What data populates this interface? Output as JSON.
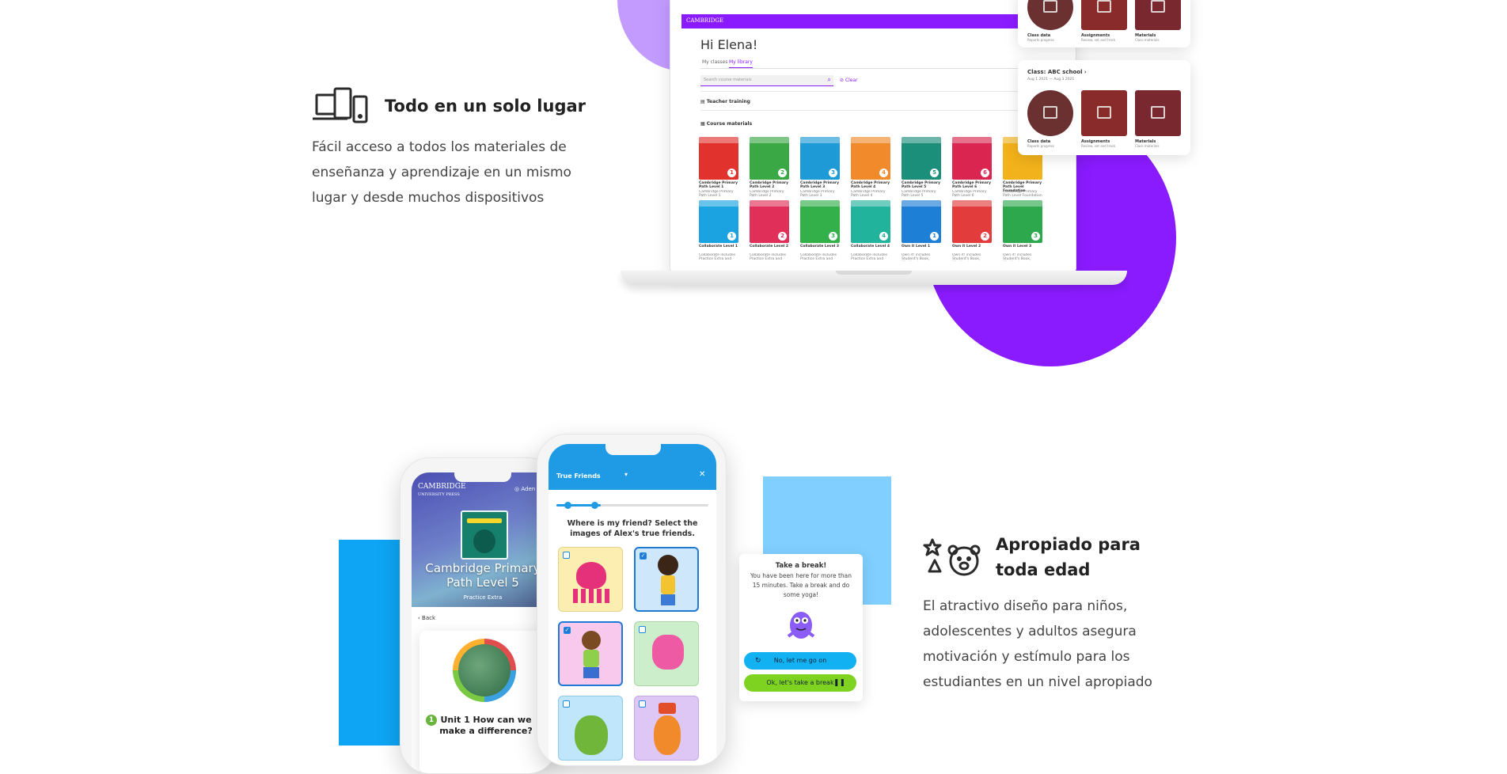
{
  "features": {
    "one_place": {
      "title": "Todo en un solo lugar",
      "description": "Fácil acceso a todos los materiales de enseñanza y aprendizaje en un mismo lugar y desde muchos dispositivos",
      "icon": "devices-icon"
    },
    "all_ages": {
      "title": "Apropiado para toda edad",
      "description": "El atractivo diseño para niños, adolescentes y adultos asegura motivación y estímulo para los estudiantes en un nivel apropiado",
      "icon": "star-triangle-bear-icon"
    }
  },
  "laptop": {
    "brand": "CAMBRIDGE",
    "greeting": "Hi Elena!",
    "tabs": [
      "My classes",
      "My library"
    ],
    "active_tab": "My library",
    "search_placeholder": "Search course materials",
    "clear_label": "Clear",
    "teacher_training": "Teacher training",
    "course_materials": "Course materials",
    "books_row1": [
      {
        "title": "Cambridge Primary Path Level 1",
        "sub": "Cambridge Primary Path Level 1",
        "color": "#e2322e",
        "num": "1"
      },
      {
        "title": "Cambridge Primary Path Level 2",
        "sub": "Cambridge Primary Path Level 2",
        "color": "#39a845",
        "num": "2"
      },
      {
        "title": "Cambridge Primary Path Level 3",
        "sub": "Cambridge Primary Path Level 3",
        "color": "#1e9ad6",
        "num": "3"
      },
      {
        "title": "Cambridge Primary Path Level 4",
        "sub": "Cambridge Primary Path Level 4",
        "color": "#f08a2b",
        "num": "4"
      },
      {
        "title": "Cambridge Primary Path Level 5",
        "sub": "Cambridge Primary Path Level 5",
        "color": "#1c8f7a",
        "num": "5"
      },
      {
        "title": "Cambridge Primary Path Level 6",
        "sub": "Cambridge Primary Path Level 6",
        "color": "#d9254f",
        "num": "6"
      },
      {
        "title": "Cambridge Primary Path Level Foundation",
        "sub": "Cambridge Primary Path Level Foundation",
        "color": "#f2b21b",
        "num": ""
      }
    ],
    "books_row2": [
      {
        "title": "Collaborate Level 1",
        "sub": "Collaborate includes Practice Extra and",
        "color": "#1aa3e0",
        "num": "1"
      },
      {
        "title": "Collaborate Level 2",
        "sub": "Collaborate includes Practice Extra and",
        "color": "#e0305a",
        "num": "2"
      },
      {
        "title": "Collaborate Level 3",
        "sub": "Collaborate includes Practice Extra and",
        "color": "#34b04a",
        "num": "3"
      },
      {
        "title": "Collaborate Level 4",
        "sub": "Collaborate includes Practice Extra and",
        "color": "#21b39c",
        "num": "4"
      },
      {
        "title": "Own it Level 1",
        "sub": "Own it! includes Student's Book, Workbook",
        "color": "#1d7fd6",
        "num": "1"
      },
      {
        "title": "Own it Level 2",
        "sub": "Own it! includes Student's Book, Workbook",
        "color": "#e23c3c",
        "num": "2"
      },
      {
        "title": "Own it Level 3",
        "sub": "Own it! includes Student's Book, Workbook",
        "color": "#2ea84d",
        "num": "3"
      }
    ]
  },
  "class_card_top": {
    "labels": [
      {
        "title": "Class data",
        "sub": "Reports progress"
      },
      {
        "title": "Assignments",
        "sub": "Review, set and track"
      },
      {
        "title": "Materials",
        "sub": "Class materials"
      }
    ]
  },
  "class_card": {
    "title": "Class: ABC school",
    "dates": "Aug 1 2021 — Aug 3 2021",
    "labels": [
      {
        "title": "Class data",
        "sub": "Reports progress"
      },
      {
        "title": "Assignments",
        "sub": "Review, set and track"
      },
      {
        "title": "Materials",
        "sub": "Class materials"
      }
    ]
  },
  "phone_left": {
    "brand": "CAMBRIDGE",
    "brand_sub": "UNIVERSITY PRESS",
    "user": "Aden",
    "course_title": "Cambridge Primary Path Level 5",
    "course_sub": "Practice Extra",
    "back": "Back",
    "unit_num": "1",
    "unit_title": "Unit 1 How can we make a difference?"
  },
  "phone_right": {
    "header": "True Friends",
    "question": "Where is my friend? Select the images of Alex's true friends."
  },
  "break_card": {
    "title": "Take a break!",
    "body": "You have been here for more than 15 minutes. Take a break and do some yoga!",
    "btn_continue": "No, let me go on",
    "btn_break": "Ok, let's take a break"
  },
  "colors": {
    "purple": "#8a1bff",
    "lilac": "#c39bff",
    "blue": "#0ea5f5",
    "light_blue": "#80cfff"
  }
}
